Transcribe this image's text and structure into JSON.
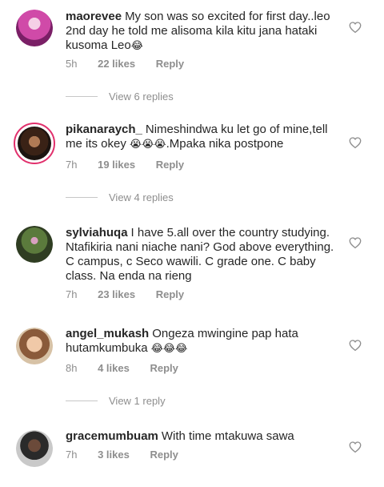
{
  "comments": [
    {
      "username": "maorevee",
      "text": "My son was so excited for first day..leo 2nd day he told me alisoma kila kitu jana hataki kusoma Leo",
      "emoji": "😂",
      "time": "5h",
      "likes": "22 likes",
      "reply": "Reply",
      "view_replies": "View 6 replies"
    },
    {
      "username": "pikanaraych_",
      "text": "Nimeshindwa ku let go of mine,tell me its okey",
      "emoji": "😭😭😭",
      "text2": ".Mpaka nika postpone",
      "time": "7h",
      "likes": "19 likes",
      "reply": "Reply",
      "view_replies": "View 4 replies"
    },
    {
      "username": "sylviahuqa",
      "text": "I have 5.all over the country studying. Ntafikiria nani niache nani? God above everything. C campus, c Seco wawili. C grade one. C baby class. Na enda na rieng",
      "time": "7h",
      "likes": "23 likes",
      "reply": "Reply"
    },
    {
      "username": "angel_mukash",
      "text": "Ongeza mwingine pap hata hutamkumbuka",
      "emoji": "😂😂😂",
      "time": "8h",
      "likes": "4 likes",
      "reply": "Reply",
      "view_replies": "View 1 reply"
    },
    {
      "username": "gracemumbuam",
      "text": "With time mtakuwa sawa",
      "time": "7h",
      "likes": "3 likes",
      "reply": "Reply"
    }
  ],
  "icons": {
    "like": "heart-outline-icon"
  },
  "colors": {
    "story_ring": "#e1306c",
    "meta": "#8e8e8e",
    "text": "#262626"
  }
}
